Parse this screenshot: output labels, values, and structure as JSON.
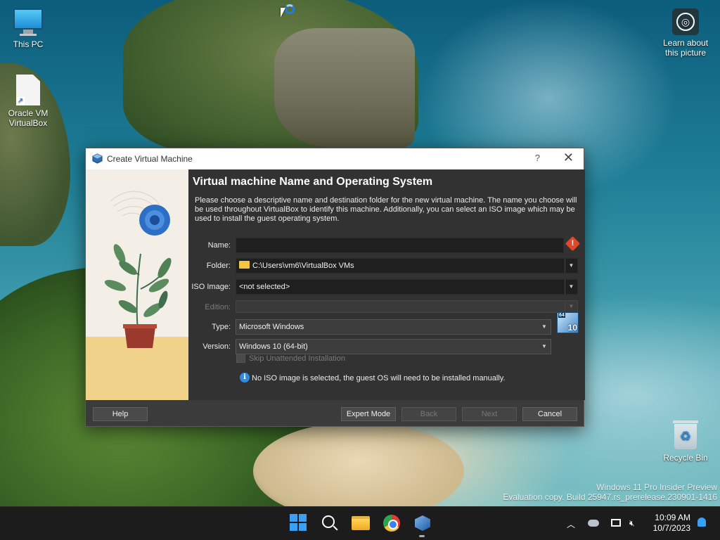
{
  "desktop": {
    "icons": {
      "this_pc": "This PC",
      "virtualbox": "Oracle VM VirtualBox",
      "learn": "Learn about this picture",
      "recycle_bin": "Recycle Bin"
    },
    "watermark": {
      "line1": "Windows 11 Pro Insider Preview",
      "line2": "Evaluation copy. Build 25947.rs_prerelease.230901-1416"
    }
  },
  "dialog": {
    "title": "Create Virtual Machine",
    "heading": "Virtual machine Name and Operating System",
    "description": "Please choose a descriptive name and destination folder for the new virtual machine. The name you choose will be used throughout VirtualBox to identify this machine. Additionally, you can select an ISO image which may be used to install the guest operating system.",
    "fields": {
      "name_label": "Name:",
      "name_value": "",
      "folder_label": "Folder:",
      "folder_value": "C:\\Users\\vm6\\VirtualBox VMs",
      "iso_label": "ISO Image:",
      "iso_value": "<not selected>",
      "edition_label": "Edition:",
      "edition_value": "",
      "type_label": "Type:",
      "type_value": "Microsoft Windows",
      "version_label": "Version:",
      "version_value": "Windows 10 (64-bit)"
    },
    "os_badge": {
      "bits": "64",
      "version": "10"
    },
    "skip_unattended_label": "Skip Unattended Installation",
    "skip_unattended_checked": false,
    "info_text": "No ISO image is selected, the guest OS will need to be installed manually.",
    "buttons": {
      "help": "Help",
      "expert_mode": "Expert Mode",
      "back": "Back",
      "next": "Next",
      "cancel": "Cancel"
    },
    "titlebar": {
      "help_glyph": "?",
      "close_glyph": "✕"
    }
  },
  "taskbar": {
    "clock_time": "10:09 AM",
    "clock_date": "10/7/2023",
    "apps": [
      "start-icon",
      "search-icon",
      "file-explorer-icon",
      "chrome-icon",
      "virtualbox-icon"
    ]
  },
  "colors": {
    "dialog_bg": "#323232",
    "titlebar_bg": "#ffffff",
    "accent": "#3aa0f5",
    "warning": "#e0482a"
  }
}
